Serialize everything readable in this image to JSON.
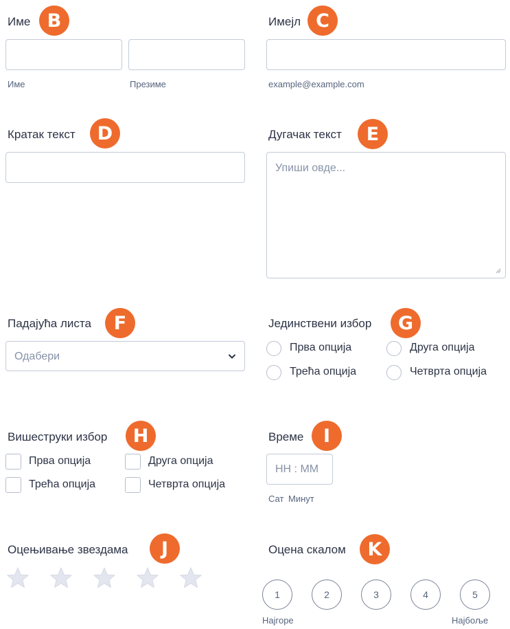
{
  "name_field": {
    "label": "Име",
    "badge": "B",
    "first_sub": "Име",
    "last_sub": "Презиме",
    "first_value": "",
    "last_value": ""
  },
  "email_field": {
    "label": "Имејл",
    "badge": "C",
    "sub": "example@example.com",
    "value": ""
  },
  "short_text": {
    "label": "Кратак текст",
    "badge": "D",
    "value": ""
  },
  "long_text": {
    "label": "Дугачак текст",
    "badge": "E",
    "placeholder": "Упиши овде..."
  },
  "dropdown": {
    "label": "Падајућа листа",
    "badge": "F",
    "selected": "Одабери"
  },
  "single_choice": {
    "label": "Јединствени избор",
    "badge": "G",
    "options": [
      "Прва опција",
      "Друга опција",
      "Трећа опција",
      "Четврта опција"
    ]
  },
  "multiple_choice": {
    "label": "Вишеструки избор",
    "badge": "H",
    "options": [
      "Прва опција",
      "Друга опција",
      "Трећа опција",
      "Четврта опција"
    ]
  },
  "time": {
    "label": "Време",
    "badge": "I",
    "placeholder": "HH : MM",
    "sub_hour": "Сат",
    "sub_minute": "Минут"
  },
  "star_rating": {
    "label": "Оцењивање звездама",
    "badge": "J",
    "stars": 5,
    "value": 0
  },
  "scale_rating": {
    "label": "Оцена скалом",
    "badge": "K",
    "values": [
      "1",
      "2",
      "3",
      "4",
      "5"
    ],
    "low_label": "Најгоре",
    "high_label": "Најбоље"
  },
  "colors": {
    "badge": "#ee6b2d",
    "border": "#c3cad8",
    "star": "#e3e6ef"
  },
  "icons": {
    "dropdown": "chevron-down-icon",
    "resize": "resize-handle-icon",
    "star": "star-icon"
  }
}
